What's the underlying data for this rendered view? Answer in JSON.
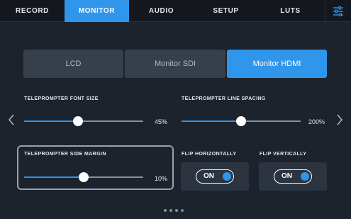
{
  "tabs": [
    {
      "label": "RECORD",
      "active": false
    },
    {
      "label": "MONITOR",
      "active": true
    },
    {
      "label": "AUDIO",
      "active": false
    },
    {
      "label": "SETUP",
      "active": false
    },
    {
      "label": "LUTS",
      "active": false
    }
  ],
  "output_selector": {
    "options": [
      {
        "label": "LCD",
        "active": false
      },
      {
        "label": "Monitor SDI",
        "active": false
      },
      {
        "label": "Monitor HDMI",
        "active": true
      }
    ]
  },
  "teleprompter_font_size": {
    "label": "TELEPROMPTER FONT SIZE",
    "value": "45%",
    "level": 0.45
  },
  "teleprompter_line_spacing": {
    "label": "TELEPROMPTER LINE SPACING",
    "value": "200%",
    "level": 0.5
  },
  "teleprompter_side_margin": {
    "label": "TELEPROMPTER SIDE MARGIN",
    "value": "10%",
    "level": 0.5
  },
  "flip_horizontally": {
    "label": "FLIP HORIZONTALLY",
    "toggle": "ON"
  },
  "flip_vertically": {
    "label": "FLIP VERTICALLY",
    "toggle": "ON"
  },
  "pagination": {
    "pages": 4,
    "current": 4
  },
  "colors": {
    "accent": "#2f96ec",
    "background": "#1d232c",
    "tabbar": "#14181e"
  },
  "icons": {
    "menu": "sliders-icon",
    "prev": "chevron-left-icon",
    "next": "chevron-right-icon"
  }
}
